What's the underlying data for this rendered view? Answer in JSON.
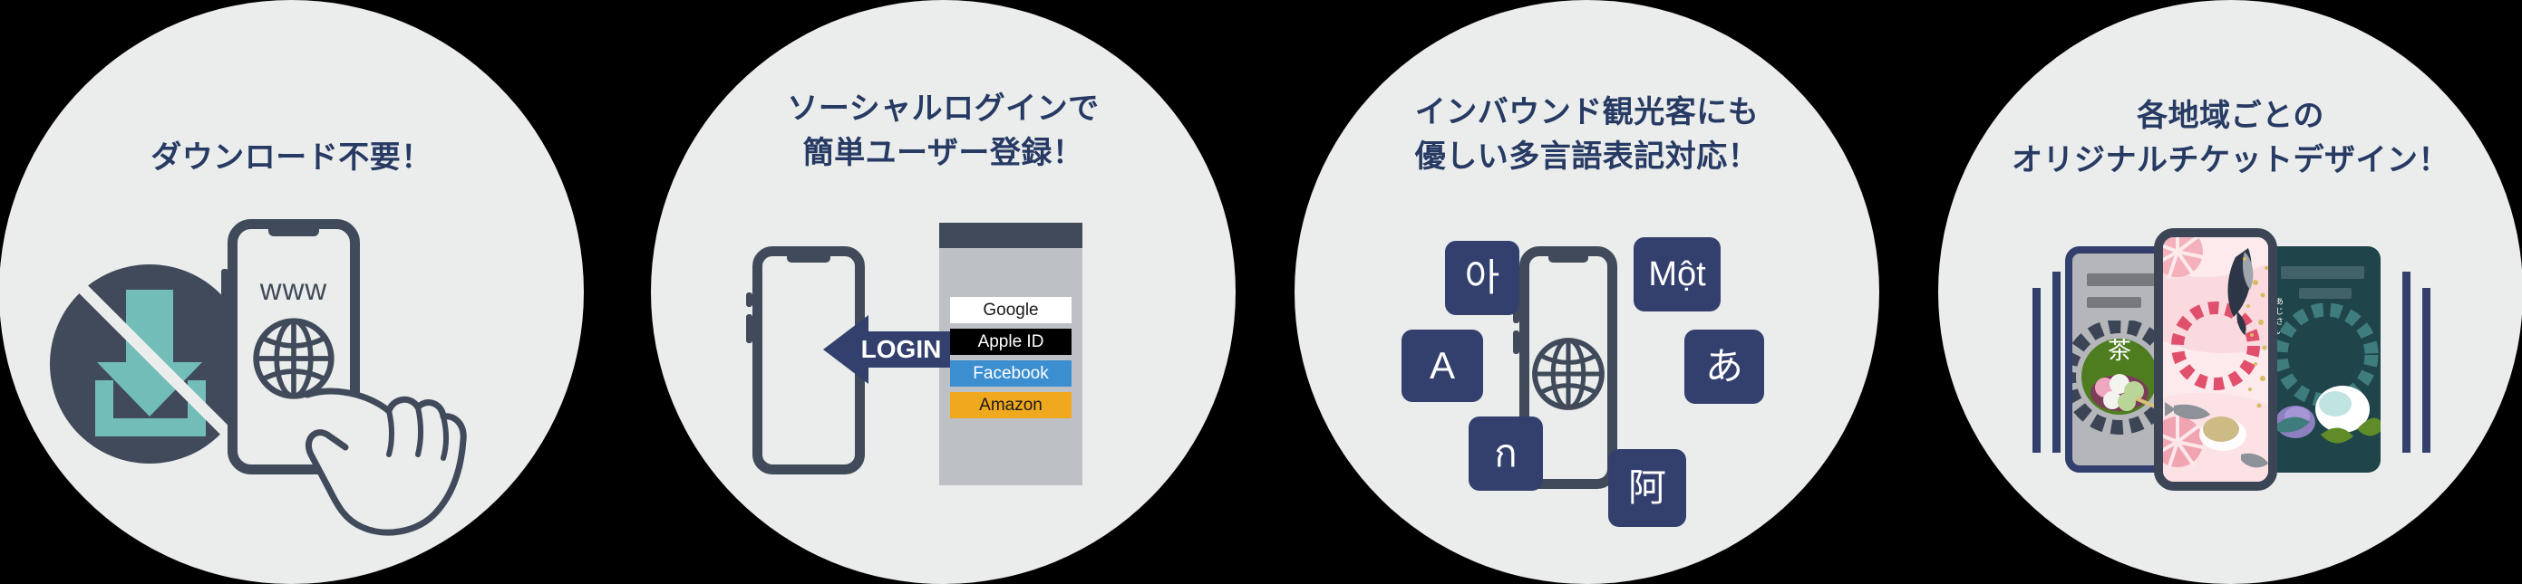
{
  "meta": {
    "background_color": "#000000",
    "disc_color": "#ebedec",
    "title_color": "#263a63",
    "accent_navy": "#33406e",
    "accent_slate": "#404a5a",
    "accent_teal": "#72bdb8"
  },
  "panels": [
    {
      "id": "no-download",
      "title": "ダウンロード不要！",
      "phone_screen_label": "www",
      "icons": [
        "no-download-icon",
        "globe-icon",
        "pointing-hand-icon"
      ]
    },
    {
      "id": "social-login",
      "title": "ソーシャルログインで\n簡単ユーザー登録！",
      "arrow_label": "LOGIN",
      "login_buttons": [
        {
          "label": "Google",
          "bg": "#ffffff",
          "fg": "#1a1a1a"
        },
        {
          "label": "Apple ID",
          "bg": "#000000",
          "fg": "#ffffff"
        },
        {
          "label": "Facebook",
          "bg": "#3b8ed0",
          "fg": "#ffffff"
        },
        {
          "label": "Amazon",
          "bg": "#f0a81e",
          "fg": "#1a1a1a"
        }
      ]
    },
    {
      "id": "multilingual",
      "title": "インバウンド観光客にも\n優しい多言語表記対応！",
      "language_badges": [
        {
          "glyph": "아",
          "lang": "korean"
        },
        {
          "glyph": "Một",
          "lang": "vietnamese"
        },
        {
          "glyph": "A",
          "lang": "english"
        },
        {
          "glyph": "あ",
          "lang": "japanese"
        },
        {
          "glyph": "ก",
          "lang": "thai"
        },
        {
          "glyph": "阿",
          "lang": "chinese"
        }
      ],
      "icons": [
        "globe-icon"
      ]
    },
    {
      "id": "original-ticket-design",
      "title": "各地域ごとの\nオリジナルチケットデザイン！",
      "ticket_left_label": "茶",
      "ticket_right_label": "あじさい",
      "icons": [
        "ticket-matcha-icon",
        "ticket-sakura-koi-icon",
        "ticket-hydrangea-icon"
      ]
    }
  ]
}
